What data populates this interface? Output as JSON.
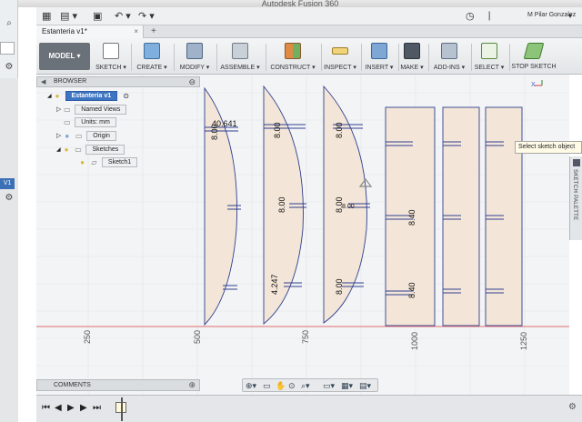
{
  "app_title": "Autodesk Fusion 360",
  "left_strip": {
    "badge": "V1"
  },
  "qat": {
    "grid_icon": "waffle-grid-icon",
    "file_icon": "file-icon",
    "save_icon": "save-icon",
    "undo_icon": "undo-icon",
    "redo_icon": "redo-icon",
    "user_name": "M Pilar Gonzalez"
  },
  "tab": {
    "label": "Estanteria v1*",
    "close": "×"
  },
  "ribbon": {
    "workspace": "MODEL",
    "groups": [
      {
        "label": "SKETCH",
        "icon": "sketch-icon",
        "color": "#c8a34a"
      },
      {
        "label": "CREATE",
        "icon": "create-icon",
        "color": "#6aa1d2"
      },
      {
        "label": "MODIFY",
        "icon": "modify-icon",
        "color": "#7d8aa0"
      },
      {
        "label": "ASSEMBLE",
        "icon": "assemble-icon",
        "color": "#9aa5b2"
      },
      {
        "label": "CONSTRUCT",
        "icon": "construct-icon",
        "color": "#d37c3d"
      },
      {
        "label": "INSPECT",
        "icon": "inspect-icon",
        "color": "#d9b74a"
      },
      {
        "label": "INSERT",
        "icon": "insert-icon",
        "color": "#5b8cc4"
      },
      {
        "label": "MAKE",
        "icon": "make-icon",
        "color": "#5d6570"
      },
      {
        "label": "ADD-INS",
        "icon": "add-ins-icon",
        "color": "#8090a5"
      },
      {
        "label": "SELECT",
        "icon": "select-icon",
        "color": "#7aa660"
      },
      {
        "label": "STOP SKETCH",
        "icon": "stop-sketch-icon",
        "color": "#6fae5a"
      }
    ]
  },
  "browser": {
    "title": "BROWSER",
    "root": "Estanteria v1",
    "named_views": "Named Views",
    "units": "Units: mm",
    "origin": "Origin",
    "sketches": "Sketches",
    "sketch1": "Sketch1"
  },
  "viewport": {
    "axis_labels": [
      "250",
      "500",
      "750",
      "1000",
      "1250"
    ],
    "dimensions": {
      "d1": "40.641",
      "d2": "8.00",
      "d3": "8.00",
      "d4": "8.00",
      "d5": "8.00",
      "d6": "4.247",
      "d7": "8.00",
      "d8": "8.00",
      "d9": "8.40",
      "d10": "8.40",
      "d11": "8.00"
    },
    "axis_x": "X"
  },
  "tooltip": "Select sketch object",
  "sketch_palette": "SKETCH PALETTE",
  "comments": {
    "title": "COMMENTS"
  },
  "colors": {
    "sketch_fill": "#f3e6d8",
    "sketch_line": "#2f3f8f",
    "dimension": "#111111",
    "highlight": "#3e74c2",
    "red_axis": "#d94040"
  }
}
